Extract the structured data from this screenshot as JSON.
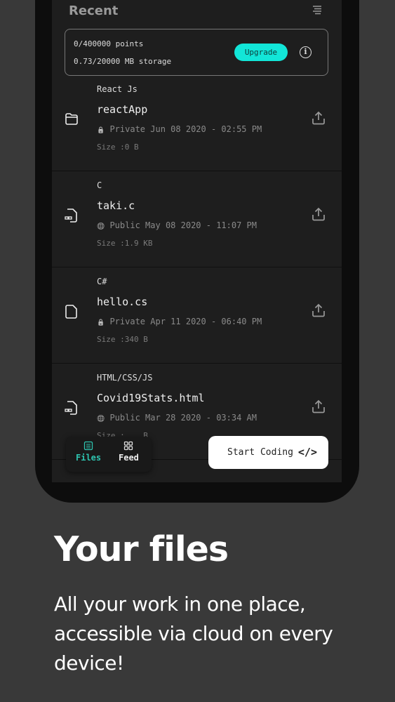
{
  "header": {
    "title": "Recent",
    "filter_icon": "filter-list-icon"
  },
  "usage": {
    "points": "0/400000 points",
    "storage": "0.73/20000 MB storage",
    "upgrade_label": "Upgrade",
    "info_icon": "info-icon"
  },
  "files": [
    {
      "language": "React Js",
      "name": "reactApp",
      "visibility": "Private",
      "date": "Jun 08 2020 - 02:55 PM",
      "size": "Size :0 B",
      "icon": "folder-icon"
    },
    {
      "language": "C",
      "name": "taki.c",
      "visibility": "Public",
      "date": "May 08 2020 - 11:07 PM",
      "size": "Size :1.9 KB",
      "icon": "code-file-icon"
    },
    {
      "language": "C#",
      "name": "hello.cs",
      "visibility": "Private",
      "date": "Apr 11 2020 - 06:40 PM",
      "size": "Size :340 B",
      "icon": "file-icon"
    },
    {
      "language": "HTML/CSS/JS",
      "name": "Covid19Stats.html",
      "visibility": "Public",
      "date": "Mar 28 2020 - 03:34 AM",
      "size": "Size :... B",
      "icon": "code-file-icon"
    }
  ],
  "nav": {
    "files": "Files",
    "feed": "Feed",
    "active": "Files",
    "accent": "#2ec4b0"
  },
  "start_coding": {
    "label": "Start Coding",
    "icon": "code-icon"
  },
  "promo": {
    "title": "Your files",
    "subtitle": "All your work in one place, accessible via cloud on every device!"
  }
}
